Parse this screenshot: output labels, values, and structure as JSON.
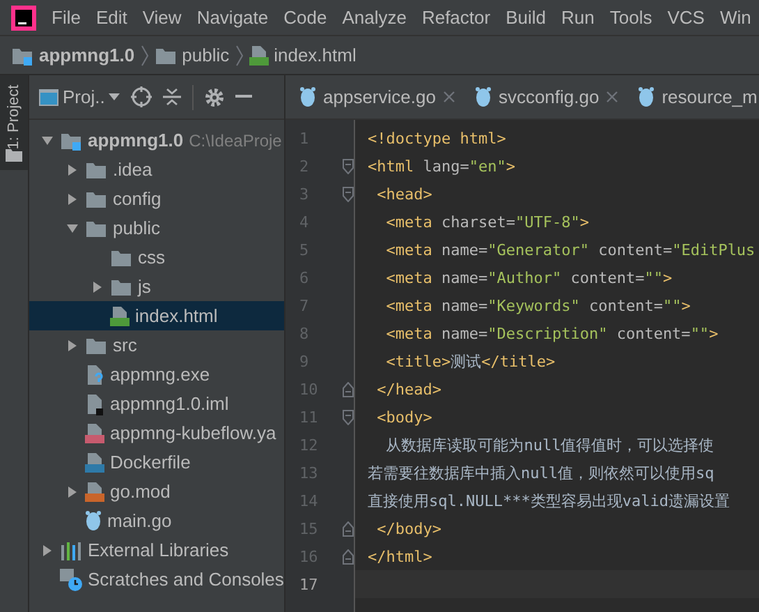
{
  "menu": [
    "File",
    "Edit",
    "View",
    "Navigate",
    "Code",
    "Analyze",
    "Refactor",
    "Build",
    "Run",
    "Tools",
    "VCS",
    "Win"
  ],
  "breadcrumb": [
    {
      "label": "appmng1.0",
      "kind": "module"
    },
    {
      "label": "public",
      "kind": "folder"
    },
    {
      "label": "index.html",
      "kind": "html"
    }
  ],
  "tool_stripe": {
    "label": "1: Project",
    "selected": true
  },
  "project_panel": {
    "view": "Proj..",
    "tree": [
      {
        "label": "appmng1.0",
        "path": "C:\\IdeaProje",
        "kind": "module",
        "expanded": true,
        "selected": false,
        "children": [
          {
            "label": ".idea",
            "kind": "folder",
            "expanded": false,
            "selected": false
          },
          {
            "label": "config",
            "kind": "folder",
            "expanded": false,
            "selected": false
          },
          {
            "label": "public",
            "kind": "folder",
            "expanded": true,
            "selected": false,
            "children": [
              {
                "label": "css",
                "kind": "folder",
                "selected": false
              },
              {
                "label": "js",
                "kind": "folder",
                "expanded": false,
                "selected": false
              },
              {
                "label": "index.html",
                "kind": "html",
                "selected": true
              }
            ]
          },
          {
            "label": "src",
            "kind": "folder",
            "expanded": false,
            "selected": false
          },
          {
            "label": "appmng.exe",
            "kind": "unknown",
            "selected": false
          },
          {
            "label": "appmng1.0.iml",
            "kind": "iml",
            "selected": false
          },
          {
            "label": "appmng-kubeflow.ya",
            "kind": "yaml",
            "selected": false
          },
          {
            "label": "Dockerfile",
            "kind": "docker",
            "selected": false
          },
          {
            "label": "go.mod",
            "kind": "dtd",
            "expanded": false,
            "selected": false
          },
          {
            "label": "main.go",
            "kind": "go",
            "selected": false
          }
        ]
      },
      {
        "label": "External Libraries",
        "kind": "libraries",
        "expanded": false,
        "selected": false
      },
      {
        "label": "Scratches and Consoles",
        "kind": "scratches",
        "selected": false
      }
    ]
  },
  "editor_tabs": [
    {
      "label": "appservice.go",
      "closable": true,
      "selected": false
    },
    {
      "label": "svcconfig.go",
      "closable": true,
      "selected": false
    },
    {
      "label": "resource_m",
      "closable": false,
      "selected": false
    }
  ],
  "editor": {
    "lines": [
      {
        "number": "1",
        "kind": "plain",
        "current": false,
        "tokens": [
          {
            "kind": "tag",
            "text": "<!doctype html>"
          }
        ]
      },
      {
        "number": "2",
        "kind": "fold-start",
        "current": false,
        "tokens": [
          {
            "kind": "tag",
            "text": "<html"
          },
          {
            "kind": "attr",
            "text": " lang="
          },
          {
            "kind": "string",
            "text": "\"en\""
          },
          {
            "kind": "tag",
            "text": ">"
          }
        ]
      },
      {
        "number": "3",
        "kind": "fold-start",
        "current": false,
        "tokens": [
          {
            "kind": "tag",
            "text": " <head>"
          }
        ]
      },
      {
        "number": "4",
        "kind": "plain",
        "current": false,
        "tokens": [
          {
            "kind": "tag",
            "text": "  <meta"
          },
          {
            "kind": "attr",
            "text": " charset="
          },
          {
            "kind": "string",
            "text": "\"UTF-8\""
          },
          {
            "kind": "tag",
            "text": ">"
          }
        ]
      },
      {
        "number": "5",
        "kind": "plain",
        "current": false,
        "tokens": [
          {
            "kind": "tag",
            "text": "  <meta"
          },
          {
            "kind": "attr",
            "text": " name="
          },
          {
            "kind": "string",
            "text": "\"Generator\""
          },
          {
            "kind": "attr",
            "text": " content="
          },
          {
            "kind": "string",
            "text": "\"EditPlus"
          }
        ]
      },
      {
        "number": "6",
        "kind": "plain",
        "current": false,
        "tokens": [
          {
            "kind": "tag",
            "text": "  <meta"
          },
          {
            "kind": "attr",
            "text": " name="
          },
          {
            "kind": "string",
            "text": "\"Author\""
          },
          {
            "kind": "attr",
            "text": " content="
          },
          {
            "kind": "string",
            "text": "\"\""
          },
          {
            "kind": "tag",
            "text": ">"
          }
        ]
      },
      {
        "number": "7",
        "kind": "plain",
        "current": false,
        "tokens": [
          {
            "kind": "tag",
            "text": "  <meta"
          },
          {
            "kind": "attr",
            "text": " name="
          },
          {
            "kind": "string",
            "text": "\"Keywords\""
          },
          {
            "kind": "attr",
            "text": " content="
          },
          {
            "kind": "string",
            "text": "\"\""
          },
          {
            "kind": "tag",
            "text": ">"
          }
        ]
      },
      {
        "number": "8",
        "kind": "plain",
        "current": false,
        "tokens": [
          {
            "kind": "tag",
            "text": "  <meta"
          },
          {
            "kind": "attr",
            "text": " name="
          },
          {
            "kind": "string",
            "text": "\"Description\""
          },
          {
            "kind": "attr",
            "text": " content="
          },
          {
            "kind": "string",
            "text": "\"\""
          },
          {
            "kind": "tag",
            "text": ">"
          }
        ]
      },
      {
        "number": "9",
        "kind": "plain",
        "current": false,
        "tokens": [
          {
            "kind": "tag",
            "text": "  <title>"
          },
          {
            "kind": "text",
            "text": "测试"
          },
          {
            "kind": "tag",
            "text": "</title>"
          }
        ]
      },
      {
        "number": "10",
        "kind": "fold-end",
        "current": false,
        "tokens": [
          {
            "kind": "tag",
            "text": " </head>"
          }
        ]
      },
      {
        "number": "11",
        "kind": "fold-start",
        "current": false,
        "tokens": [
          {
            "kind": "tag",
            "text": " <body>"
          }
        ]
      },
      {
        "number": "12",
        "kind": "plain",
        "current": false,
        "tokens": [
          {
            "kind": "text",
            "text": "  从数据库读取可能为null值得值时，可以选择使"
          }
        ]
      },
      {
        "number": "13",
        "kind": "plain",
        "current": false,
        "tokens": [
          {
            "kind": "text",
            "text": "若需要往数据库中插入null值，则依然可以使用sq"
          }
        ]
      },
      {
        "number": "14",
        "kind": "plain",
        "current": false,
        "tokens": [
          {
            "kind": "text",
            "text": "直接使用sql.NULL***类型容易出现valid遗漏设置"
          }
        ]
      },
      {
        "number": "15",
        "kind": "fold-end",
        "current": false,
        "tokens": [
          {
            "kind": "tag",
            "text": " </body>"
          }
        ]
      },
      {
        "number": "16",
        "kind": "fold-end",
        "current": false,
        "tokens": [
          {
            "kind": "tag",
            "text": "</html>"
          }
        ]
      },
      {
        "number": "17",
        "kind": "plain",
        "current": true
      }
    ]
  }
}
